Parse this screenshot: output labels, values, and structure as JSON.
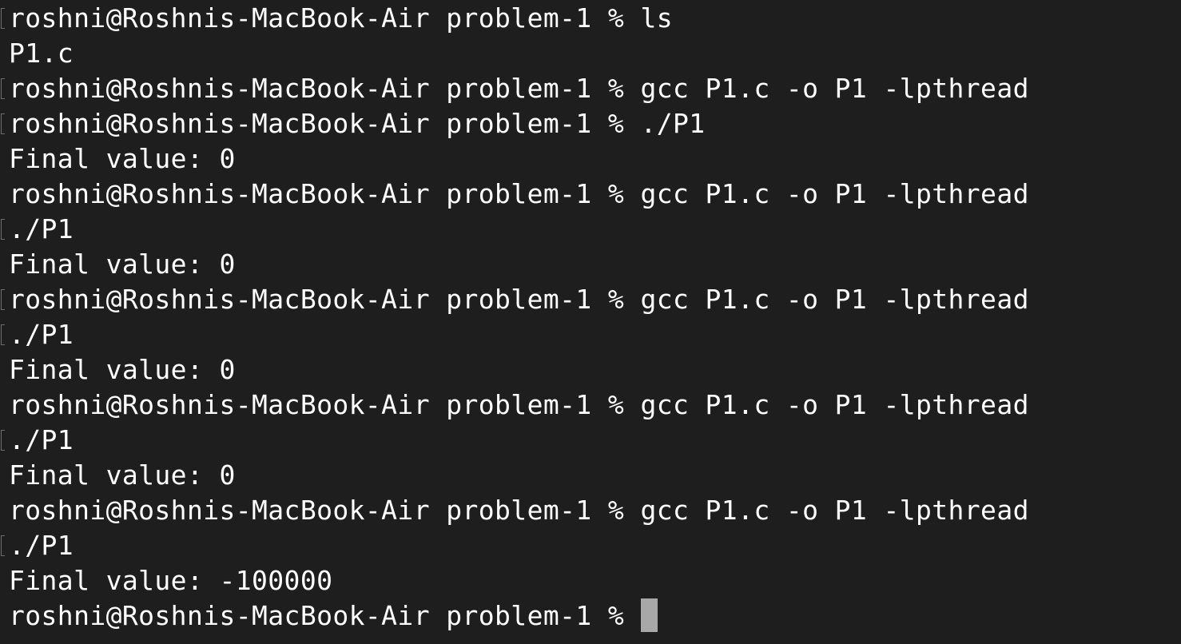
{
  "terminal": {
    "lines": [
      {
        "text": "roshni@Roshnis-MacBook-Air problem-1 % ls",
        "mark": true
      },
      {
        "text": "P1.c",
        "mark": false
      },
      {
        "text": "roshni@Roshnis-MacBook-Air problem-1 % gcc P1.c -o P1 -lpthread",
        "mark": true
      },
      {
        "text": "roshni@Roshnis-MacBook-Air problem-1 % ./P1",
        "mark": true
      },
      {
        "text": "Final value: 0",
        "mark": false
      },
      {
        "text": "roshni@Roshnis-MacBook-Air problem-1 % gcc P1.c -o P1 -lpthread",
        "mark": false
      },
      {
        "text": "./P1",
        "mark": true
      },
      {
        "text": "Final value: 0",
        "mark": false
      },
      {
        "text": "roshni@Roshnis-MacBook-Air problem-1 % gcc P1.c -o P1 -lpthread",
        "mark": true
      },
      {
        "text": "./P1",
        "mark": true
      },
      {
        "text": "Final value: 0",
        "mark": false
      },
      {
        "text": "roshni@Roshnis-MacBook-Air problem-1 % gcc P1.c -o P1 -lpthread",
        "mark": false
      },
      {
        "text": "./P1",
        "mark": true
      },
      {
        "text": "Final value: 0",
        "mark": false
      },
      {
        "text": "roshni@Roshnis-MacBook-Air problem-1 % gcc P1.c -o P1 -lpthread",
        "mark": false
      },
      {
        "text": "./P1",
        "mark": true
      },
      {
        "text": "Final value: -100000",
        "mark": false
      }
    ],
    "current_prompt": "roshni@Roshnis-MacBook-Air problem-1 % ",
    "colors": {
      "background": "#1e1e1e",
      "foreground": "#ffffff",
      "cursor": "#a8a8a8",
      "mark": "#6f6f6f"
    }
  }
}
